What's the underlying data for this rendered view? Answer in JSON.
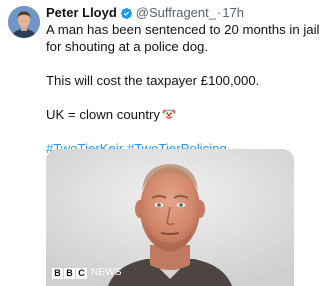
{
  "tweet": {
    "author": {
      "display_name": "Peter Lloyd",
      "handle": "@Suffragent_",
      "verified": true,
      "avatar_icon": "profile-photo"
    },
    "separator": "·",
    "time": "17h",
    "lines": {
      "line1": "A man has been sentenced to 20 months in jail",
      "line2": "for shouting at a police dog.",
      "line3": "This will cost the taxpayer £100,000.",
      "line4": "UK = clown country"
    },
    "emoji_icon": "clown-face-emoji",
    "hashtags": [
      "#TwoTierKeir",
      "#TwoTierPolicing"
    ],
    "media": {
      "logo_letters": [
        "B",
        "B",
        "C"
      ],
      "logo_word": "NEWS"
    },
    "colors": {
      "text": "#0f1419",
      "secondary": "#536471",
      "link": "#1d9bf0",
      "verified_badge": "#1d9bf0"
    }
  }
}
